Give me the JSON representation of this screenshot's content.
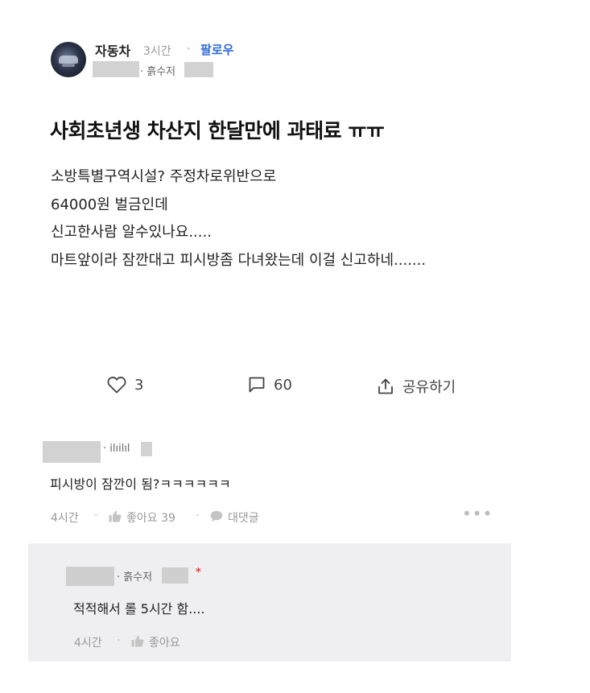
{
  "post": {
    "author": "자동차",
    "time": "3시간",
    "follow_label": "팔로우",
    "company": "· 흙수저",
    "title": "사회초년생 차산지 한달만에 과태료 ㅠㅠ",
    "body_lines": [
      "소방특별구역시설? 주정차로위반으로",
      "64000원 벌금인데",
      "신고한사람 알수있나요.....",
      "마트앞이라 잠깐대고 피시방좀 다녀왔는데 이걸 신고하네......."
    ],
    "likes": "3",
    "comments": "60",
    "share_label": "공유하기"
  },
  "comment1": {
    "company_id": "· ilıilıl",
    "text": "피시방이 잠깐이 됨?ㅋㅋㅋㅋㅋㅋ",
    "time": "4시간",
    "like_label": "좋아요 39",
    "reply_label": "대댓글",
    "more_label": "•••"
  },
  "reply1": {
    "company": "· 흙수저",
    "star": "*",
    "text": "적적해서 롤 5시간 함....",
    "time": "4시간",
    "like_label": "좋아요"
  },
  "colors": {
    "follow": "#2e6bd6",
    "star": "#e0443e",
    "reply_bg": "#efeff1"
  }
}
